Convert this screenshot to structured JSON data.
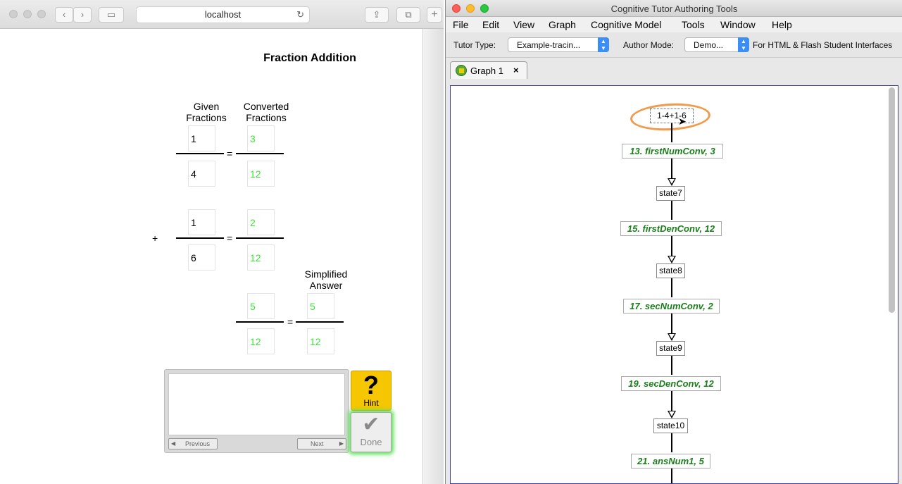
{
  "browser": {
    "url": "localhost",
    "back_glyph": "‹",
    "forward_glyph": "›",
    "sidebar_glyph": "▭",
    "share_glyph": "⇪",
    "tabs_glyph": "⧉",
    "newtab_glyph": "+",
    "reload_glyph": "↻"
  },
  "tutor": {
    "title": "Fraction Addition",
    "headers": {
      "given": "Given Fractions",
      "converted": "Converted Fractions",
      "simplified": "Simplified Answer"
    },
    "given1": {
      "num": "1",
      "den": "4"
    },
    "converted1": {
      "num": "3",
      "den": "12"
    },
    "given2": {
      "num": "1",
      "den": "6"
    },
    "converted2": {
      "num": "2",
      "den": "12"
    },
    "sum": {
      "num": "5",
      "den": "12"
    },
    "simplified": {
      "num": "5",
      "den": "12"
    },
    "operators": {
      "equals": "=",
      "plus": "+"
    },
    "feedback": {
      "text": "",
      "previous": "Previous",
      "next": "Next",
      "prev_arrow": "◀",
      "next_arrow": "▶"
    },
    "hint": {
      "glyph": "?",
      "label": "Hint"
    },
    "done": {
      "glyph": "✔",
      "label": "Done"
    }
  },
  "ctat": {
    "window_title": "Cognitive Tutor Authoring Tools",
    "menus": [
      "File",
      "Edit",
      "View",
      "Graph",
      "Cognitive Model",
      "Tools",
      "Window",
      "Help"
    ],
    "toolbar": {
      "tutor_type_label": "Tutor Type:",
      "tutor_type_value": "Example-tracin...",
      "author_mode_label": "Author Mode:",
      "author_mode_value": "Demo...",
      "interface_note": "For HTML & Flash Student Interfaces"
    },
    "tab": {
      "label": "Graph 1",
      "close": "×"
    },
    "graph": {
      "start_node": "1-4+1-6",
      "states": [
        "state7",
        "state8",
        "state9",
        "state10"
      ],
      "edges": [
        "13. firstNumConv, 3",
        "15. firstDenConv, 12",
        "17. secNumConv, 2",
        "19. secDenConv, 12",
        "21. ansNum1, 5"
      ]
    }
  }
}
